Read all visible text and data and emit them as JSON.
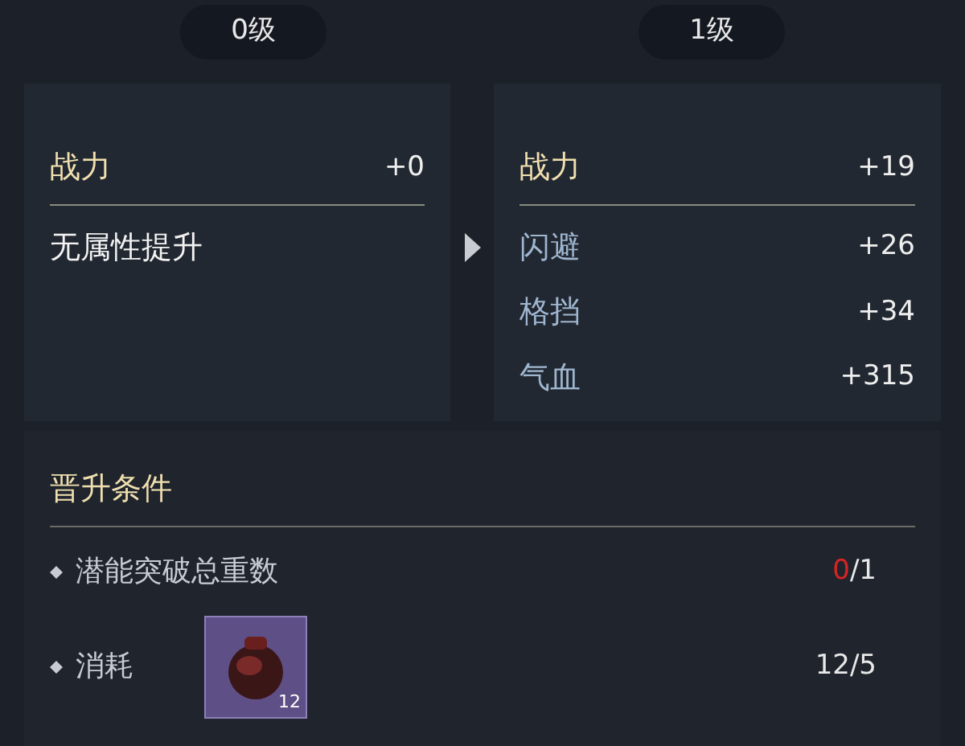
{
  "levels": [
    {
      "label": "0级"
    },
    {
      "label": "1级"
    }
  ],
  "current_panel": {
    "stats": [
      {
        "kind": "power",
        "name": "战力",
        "value": "+0"
      }
    ],
    "note": "无属性提升"
  },
  "next_panel": {
    "stats": [
      {
        "kind": "power",
        "name": "战力",
        "value": "+19"
      },
      {
        "kind": "attr",
        "name": "闪避",
        "value": "+26"
      },
      {
        "kind": "attr",
        "name": "格挡",
        "value": "+34"
      },
      {
        "kind": "attr",
        "name": "气血",
        "value": "+315"
      }
    ]
  },
  "conditions": {
    "title": "晋升条件",
    "items": [
      {
        "kind": "text",
        "label": "潜能突破总重数",
        "current": "0",
        "met": false,
        "rest": "/1"
      },
      {
        "kind": "item",
        "label": "消耗",
        "item_count": "12",
        "current": "12",
        "met": true,
        "rest": "/5"
      }
    ]
  }
}
